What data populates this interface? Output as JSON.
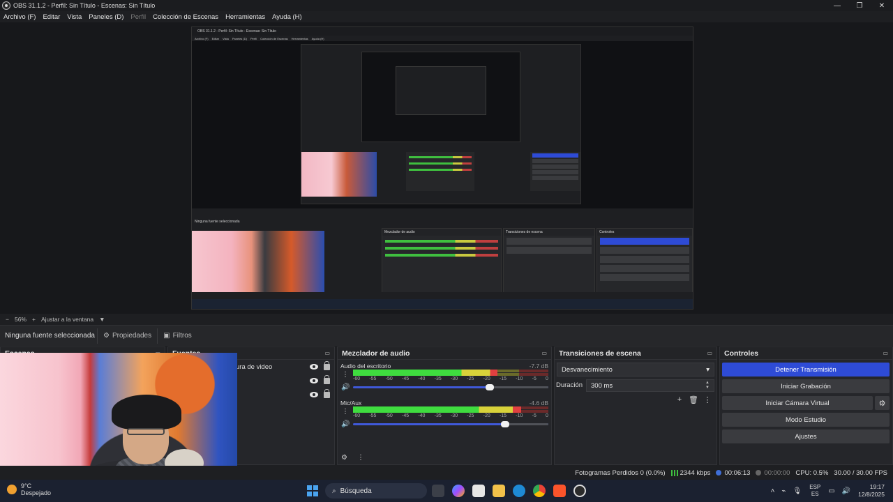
{
  "window": {
    "title": "OBS 31.1.2 - Perfil: Sin Título - Escenas: Sin Título",
    "minimize": "—",
    "maximize": "❐",
    "close": "✕"
  },
  "menu": [
    {
      "label": "Archivo (F)",
      "disabled": false
    },
    {
      "label": "Editar",
      "disabled": false
    },
    {
      "label": "Vista",
      "disabled": false
    },
    {
      "label": "Paneles (D)",
      "disabled": false
    },
    {
      "label": "Perfil",
      "disabled": true
    },
    {
      "label": "Colección de Escenas",
      "disabled": false
    },
    {
      "label": "Herramientas",
      "disabled": false
    },
    {
      "label": "Ayuda (H)",
      "disabled": false
    }
  ],
  "zoom": {
    "value": "56%",
    "plus": "+",
    "fit_label": "Ajustar a la ventana",
    "caret": "▼"
  },
  "source_toolbar": {
    "no_source": "Ninguna fuente seleccionada",
    "properties": "Propiedades",
    "filters": "Filtros"
  },
  "docks": {
    "scenes_title": "Escenas",
    "sources_title": "Fuentes",
    "mixer_title": "Mezclador de audio",
    "transitions_title": "Transiciones de escena",
    "controls_title": "Controles"
  },
  "sources": [
    {
      "name": "ura de video"
    },
    {
      "name": ""
    },
    {
      "name": ""
    }
  ],
  "mixer": {
    "ticks": [
      "-60",
      "-55",
      "-50",
      "-45",
      "-40",
      "-35",
      "-30",
      "-25",
      "-20",
      "-15",
      "-10",
      "-5",
      "0"
    ],
    "channels": [
      {
        "name": "Audio del escritorio",
        "db": "-7.7 dB",
        "level_pct": 74,
        "volume_pct": 70
      },
      {
        "name": "Mic/Aux",
        "db": "-4.6 dB",
        "level_pct": 86,
        "volume_pct": 78
      }
    ]
  },
  "transitions": {
    "selected": "Desvanecimiento",
    "duration_label": "Duración",
    "duration_value": "300 ms"
  },
  "controls": {
    "stop_stream": "Detener Transmisión",
    "start_recording": "Iniciar Grabación",
    "start_virtual_cam": "Iniciar Cámara Virtual",
    "studio_mode": "Modo Estudio",
    "settings": "Ajustes"
  },
  "status": {
    "dropped_frames": "Fotogramas Perdidos 0 (0.0%)",
    "bitrate": "2344 kbps",
    "stream_time": "00:06:13",
    "record_time": "00:00:00",
    "cpu": "CPU: 0.5%",
    "fps": "30.00 / 30.00 FPS"
  },
  "taskbar": {
    "weather_temp": "9°C",
    "weather_desc": "Despejado",
    "search_placeholder": "Búsqueda",
    "lang_top": "ESP",
    "lang_bottom": "ES",
    "time": "19:17",
    "date": "12/8/2025"
  },
  "nested": {
    "title": "OBS 31.1.2 - Perfil: Sin Título - Escenas: Sin Título",
    "menu": [
      "Archivo (F)",
      "Editar",
      "Vista",
      "Paneles (D)",
      "Perfil",
      "Colección de Escenas",
      "Herramientas",
      "Ayuda (H)"
    ],
    "no_source": "Ninguna fuente seleccionada",
    "mixer_title": "Mezclador de audio",
    "transitions_title": "Transiciones de escena",
    "controls_title": "Controles",
    "stop_stream": "Detener Transmisión"
  },
  "colors": {
    "accent": "#2e4bd6",
    "meter_green": "#3fdc3f",
    "meter_yellow": "#d8d23a",
    "meter_red": "#e04040"
  }
}
